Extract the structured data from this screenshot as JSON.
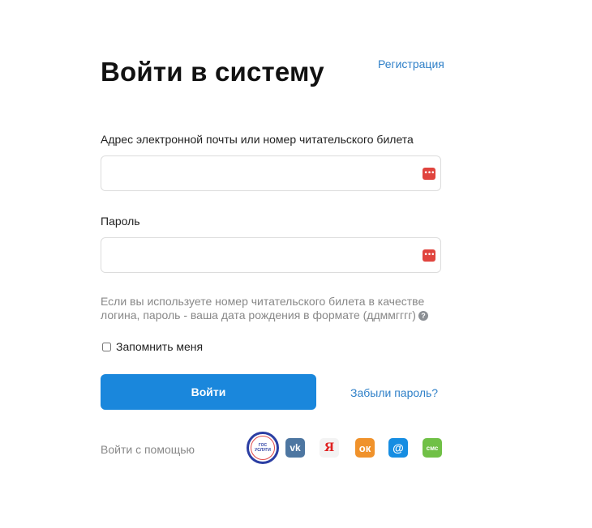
{
  "header": {
    "title": "Войти в систему",
    "register_link": "Регистрация"
  },
  "form": {
    "email_label": "Адрес электронной почты или номер читательского билета",
    "email_value": "",
    "password_label": "Пароль",
    "password_value": "",
    "password_manager_icon": "•••",
    "hint": "Если вы используете номер читательского билета в качестве логина, пароль - ваша дата рождения в формате (ддммгггг)",
    "help_icon": "?",
    "remember_label": "Запомнить меня",
    "remember_checked": false,
    "login_button": "Войти",
    "forgot_link": "Забыли пароль?"
  },
  "social": {
    "label": "Войти с помощью",
    "providers": [
      {
        "name": "gosuslugi-icon",
        "glyph_top": "ГОС",
        "glyph_bottom": "УСЛУГИ",
        "color": "#2b3ea3"
      },
      {
        "name": "vk-icon",
        "glyph": "vk",
        "color": "#4d76a1"
      },
      {
        "name": "yandex-icon",
        "glyph": "Я",
        "color": "#e02020"
      },
      {
        "name": "odnoklassniki-icon",
        "glyph": "ок",
        "color": "#f0922b"
      },
      {
        "name": "mailru-icon",
        "glyph": "@",
        "color": "#168de2"
      },
      {
        "name": "sms-icon",
        "glyph": "смс",
        "color": "#70c046"
      }
    ]
  },
  "colors": {
    "accent": "#1a87dc",
    "link": "#2f80c8",
    "muted_text": "#888888"
  }
}
